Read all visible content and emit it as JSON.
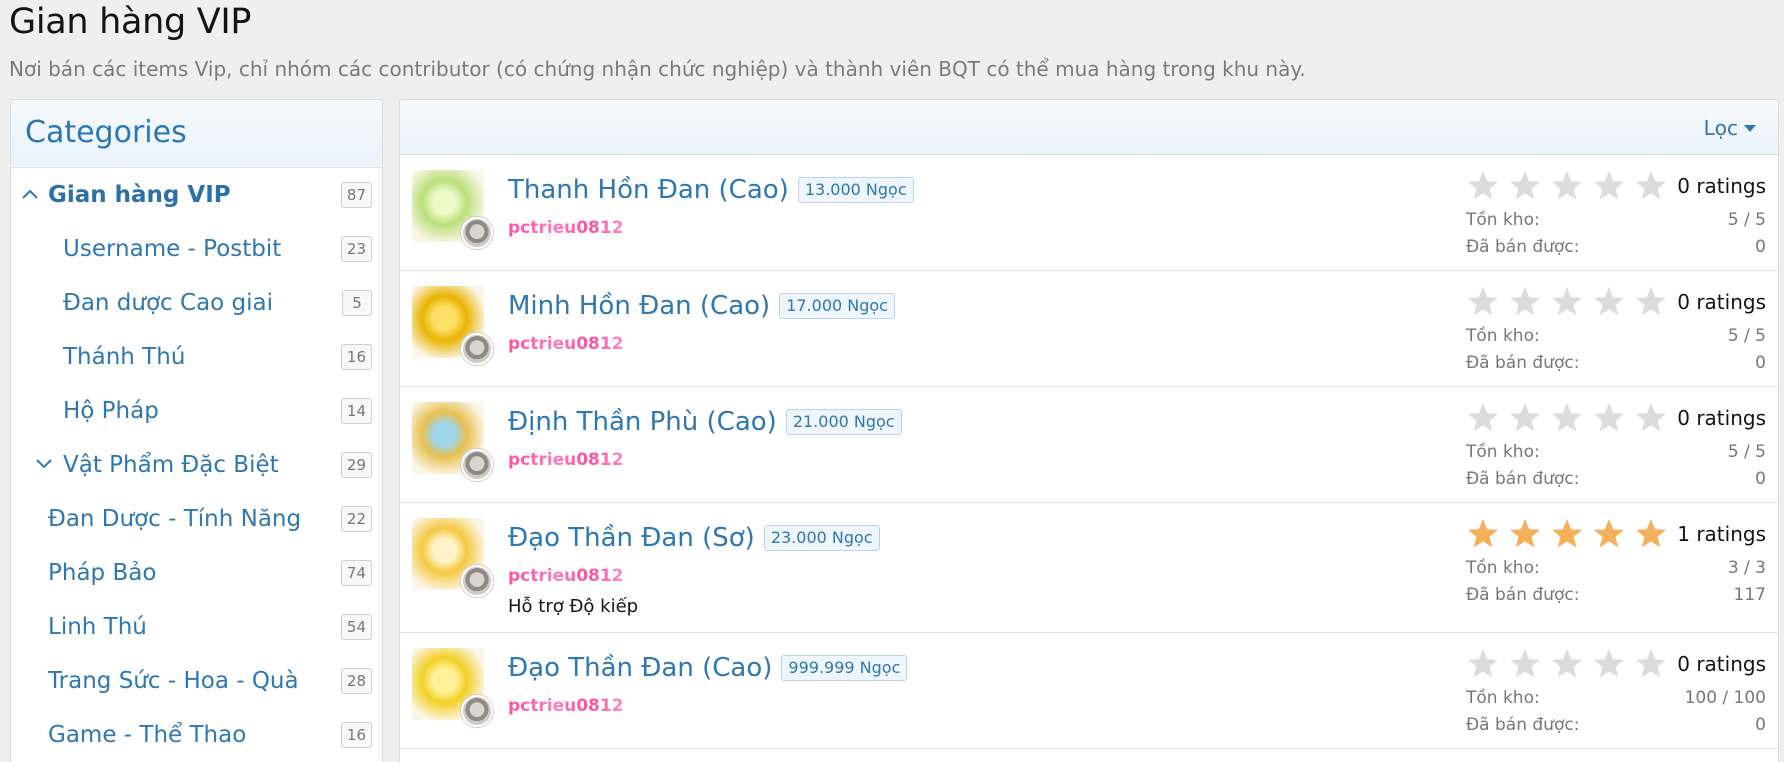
{
  "page": {
    "title": "Gian hàng VIP",
    "description": "Nơi bán các items Vip, chỉ nhóm các contributor (có chứng nhận chức nghiệp) và thành viên BQT có thể mua hàng trong khu này."
  },
  "sidebar": {
    "title": "Categories",
    "items": [
      {
        "label": "Gian hàng VIP",
        "count": "87",
        "chevron": "up",
        "bold": true,
        "indent": 1
      },
      {
        "label": "Username - Postbit",
        "count": "23",
        "indent": 2
      },
      {
        "label": "Đan dược Cao giai",
        "count": "5",
        "indent": 2
      },
      {
        "label": "Thánh Thú",
        "count": "16",
        "indent": 2
      },
      {
        "label": "Hộ Pháp",
        "count": "14",
        "indent": 2
      },
      {
        "label": "Vật Phẩm Đặc Biệt",
        "count": "29",
        "chevron": "down",
        "indent": 2
      },
      {
        "label": "Đan Dược - Tính Năng",
        "count": "22",
        "indent": 1
      },
      {
        "label": "Pháp Bảo",
        "count": "74",
        "indent": 1
      },
      {
        "label": "Linh Thú",
        "count": "54",
        "indent": 1
      },
      {
        "label": "Trang Sức - Hoa - Quà",
        "count": "28",
        "indent": 1
      },
      {
        "label": "Game - Thể Thao",
        "count": "16",
        "indent": 1
      }
    ]
  },
  "main": {
    "filter_label": "Lọc",
    "stock_label": "Tồn kho:",
    "sold_label": "Đã bán được:",
    "products": [
      {
        "name": "Thanh Hồn Đan (Cao)",
        "price": "13.000 Ngọc",
        "seller": "pctrieu0812",
        "rating": 0,
        "ratings_text": "0 ratings",
        "stock": "5 / 5",
        "sold": "0",
        "desc": "",
        "thumb_color": "#b9e07a",
        "thumb_accent": "#eef9c8"
      },
      {
        "name": "Minh Hồn Đan (Cao)",
        "price": "17.000 Ngọc",
        "seller": "pctrieu0812",
        "rating": 0,
        "ratings_text": "0 ratings",
        "stock": "5 / 5",
        "sold": "0",
        "desc": "",
        "thumb_color": "#e9b400",
        "thumb_accent": "#ffe066"
      },
      {
        "name": "Định Thần Phù (Cao)",
        "price": "21.000 Ngọc",
        "seller": "pctrieu0812",
        "rating": 0,
        "ratings_text": "0 ratings",
        "stock": "5 / 5",
        "sold": "0",
        "desc": "",
        "thumb_color": "#e8c050",
        "thumb_accent": "#9fd5e8"
      },
      {
        "name": "Đạo Thần Đan (Sơ)",
        "price": "23.000 Ngọc",
        "seller": "pctrieu0812",
        "rating": 5,
        "ratings_text": "1 ratings",
        "stock": "3 / 3",
        "sold": "117",
        "desc": "Hỗ trợ Độ kiếp",
        "thumb_color": "#f5c842",
        "thumb_accent": "#fff4c8"
      },
      {
        "name": "Đạo Thần Đan (Cao)",
        "price": "999.999 Ngọc",
        "seller": "pctrieu0812",
        "rating": 0,
        "ratings_text": "0 ratings",
        "stock": "100 / 100",
        "sold": "0",
        "desc": "",
        "thumb_color": "#f2d028",
        "thumb_accent": "#fff39a"
      }
    ]
  },
  "colors": {
    "link": "#2e77b1",
    "star_filled": "#f5b15a",
    "star_empty": "#dcdcdc"
  }
}
